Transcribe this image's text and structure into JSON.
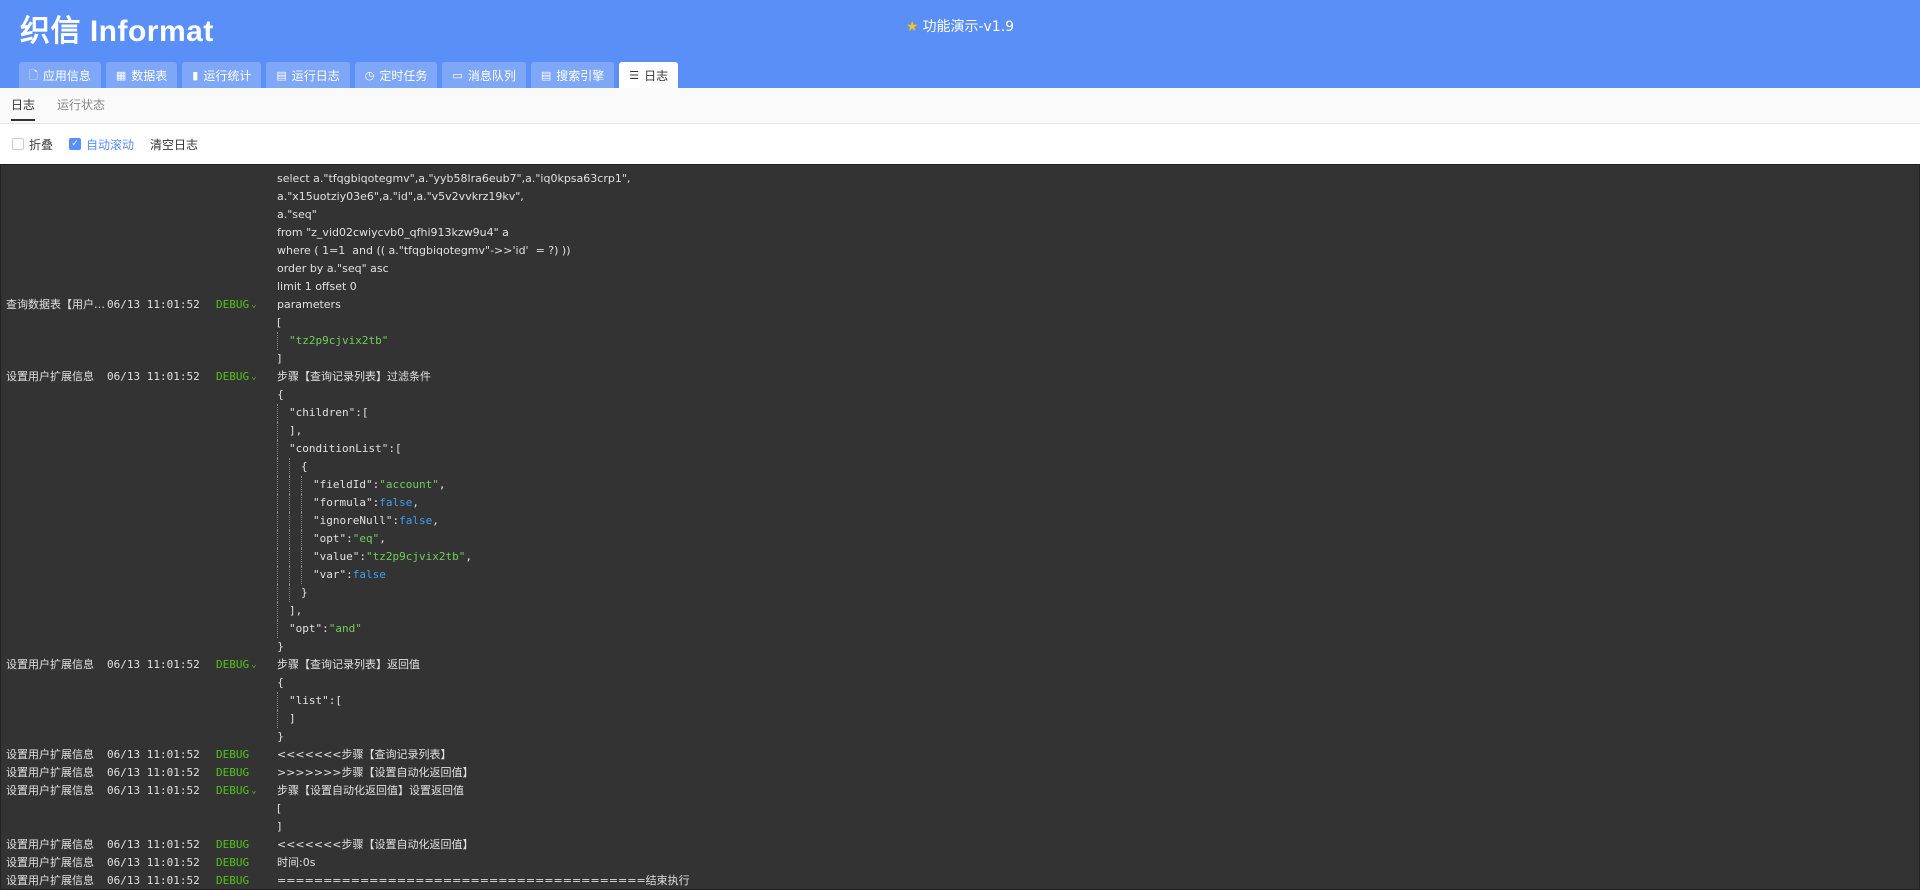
{
  "app": {
    "logo": "织信 Informat",
    "title": "功能演示-v1.9",
    "title_icon": "star-icon"
  },
  "tabs": [
    {
      "label": "应用信息",
      "icon": "document-icon",
      "glyph": "🗋"
    },
    {
      "label": "数据表",
      "icon": "table-icon",
      "glyph": "▦"
    },
    {
      "label": "运行统计",
      "icon": "bar-chart-icon",
      "glyph": "▮"
    },
    {
      "label": "运行日志",
      "icon": "log-icon",
      "glyph": "▤"
    },
    {
      "label": "定时任务",
      "icon": "clock-icon",
      "glyph": "◷"
    },
    {
      "label": "消息队列",
      "icon": "message-icon",
      "glyph": "▭"
    },
    {
      "label": "搜索引擎",
      "icon": "search-engine-icon",
      "glyph": "▤"
    },
    {
      "label": "日志",
      "icon": "list-icon",
      "glyph": "☰",
      "active": true
    }
  ],
  "subtabs": {
    "log": "日志",
    "status": "运行状态"
  },
  "toolbar": {
    "fold": "折叠",
    "autoscroll": "自动滚动",
    "clear": "清空日志"
  },
  "log": {
    "rows": [
      {
        "text": "select a.\"tfqgbiqotegmv\",a.\"yyb58lra6eub7\",a.\"iq0kpsa63crp1\","
      },
      {
        "text": "a.\"x15uotziy03e6\",a.\"id\",a.\"v5v2vvkrz19kv\","
      },
      {
        "text": "a.\"seq\""
      },
      {
        "text": "from \"z_vid02cwiycvb0_qfhi913kzw9u4\" a"
      },
      {
        "text": "where ( 1=1  and (( a.\"tfqgbiqotegmv\"->>'id'  = ?) ))"
      },
      {
        "text": "order by a.\"seq\" asc"
      },
      {
        "text": "limit 1 offset 0"
      },
      {
        "src": "查询数据表【用户扩展信息】",
        "time": "06/13 11:01:52",
        "level": "DEBUG",
        "chev": true,
        "text": "parameters"
      },
      {
        "text": "["
      },
      {
        "guides": 1,
        "val": "\"tz2p9cjvix2tb\"",
        "vtype": "str"
      },
      {
        "text": "]"
      },
      {
        "src": "设置用户扩展信息",
        "time": "06/13 11:01:52",
        "level": "DEBUG",
        "chev": true,
        "text": "步骤【查询记录列表】过滤条件"
      },
      {
        "text": "{"
      },
      {
        "guides": 1,
        "key": "\"children\":["
      },
      {
        "guides": 1,
        "key": "],"
      },
      {
        "guides": 1,
        "key": "\"conditionList\":["
      },
      {
        "guides": 2,
        "key": "{"
      },
      {
        "guides": 3,
        "key": "\"fieldId\":",
        "val": "\"account\"",
        "vtype": "str",
        "tail": ","
      },
      {
        "guides": 3,
        "key": "\"formula\":",
        "val": "false",
        "vtype": "bool",
        "tail": ","
      },
      {
        "guides": 3,
        "key": "\"ignoreNull\":",
        "val": "false",
        "vtype": "bool",
        "tail": ","
      },
      {
        "guides": 3,
        "key": "\"opt\":",
        "val": "\"eq\"",
        "vtype": "str",
        "tail": ","
      },
      {
        "guides": 3,
        "key": "\"value\":",
        "val": "\"tz2p9cjvix2tb\"",
        "vtype": "str",
        "tail": ","
      },
      {
        "guides": 3,
        "key": "\"var\":",
        "val": "false",
        "vtype": "bool"
      },
      {
        "guides": 2,
        "key": "}"
      },
      {
        "guides": 1,
        "key": "],"
      },
      {
        "guides": 1,
        "key": "\"opt\":",
        "val": "\"and\"",
        "vtype": "str"
      },
      {
        "text": "}"
      },
      {
        "src": "设置用户扩展信息",
        "time": "06/13 11:01:52",
        "level": "DEBUG",
        "chev": true,
        "text": "步骤【查询记录列表】返回值"
      },
      {
        "text": "{"
      },
      {
        "guides": 1,
        "key": "\"list\":["
      },
      {
        "guides": 1,
        "key": "]"
      },
      {
        "text": "}"
      },
      {
        "src": "设置用户扩展信息",
        "time": "06/13 11:01:52",
        "level": "DEBUG",
        "text": "<<<<<<<步骤【查询记录列表】"
      },
      {
        "src": "设置用户扩展信息",
        "time": "06/13 11:01:52",
        "level": "DEBUG",
        "text": ">>>>>>>步骤【设置自动化返回值】"
      },
      {
        "src": "设置用户扩展信息",
        "time": "06/13 11:01:52",
        "level": "DEBUG",
        "chev": true,
        "text": "步骤【设置自动化返回值】设置返回值"
      },
      {
        "text": "["
      },
      {
        "text": "]"
      },
      {
        "src": "设置用户扩展信息",
        "time": "06/13 11:01:52",
        "level": "DEBUG",
        "text": "<<<<<<<步骤【设置自动化返回值】"
      },
      {
        "src": "设置用户扩展信息",
        "time": "06/13 11:01:52",
        "level": "DEBUG",
        "text": "时间:0s"
      },
      {
        "src": "设置用户扩展信息",
        "time": "06/13 11:01:52",
        "level": "DEBUG",
        "text": "========================================结束执行"
      }
    ]
  }
}
